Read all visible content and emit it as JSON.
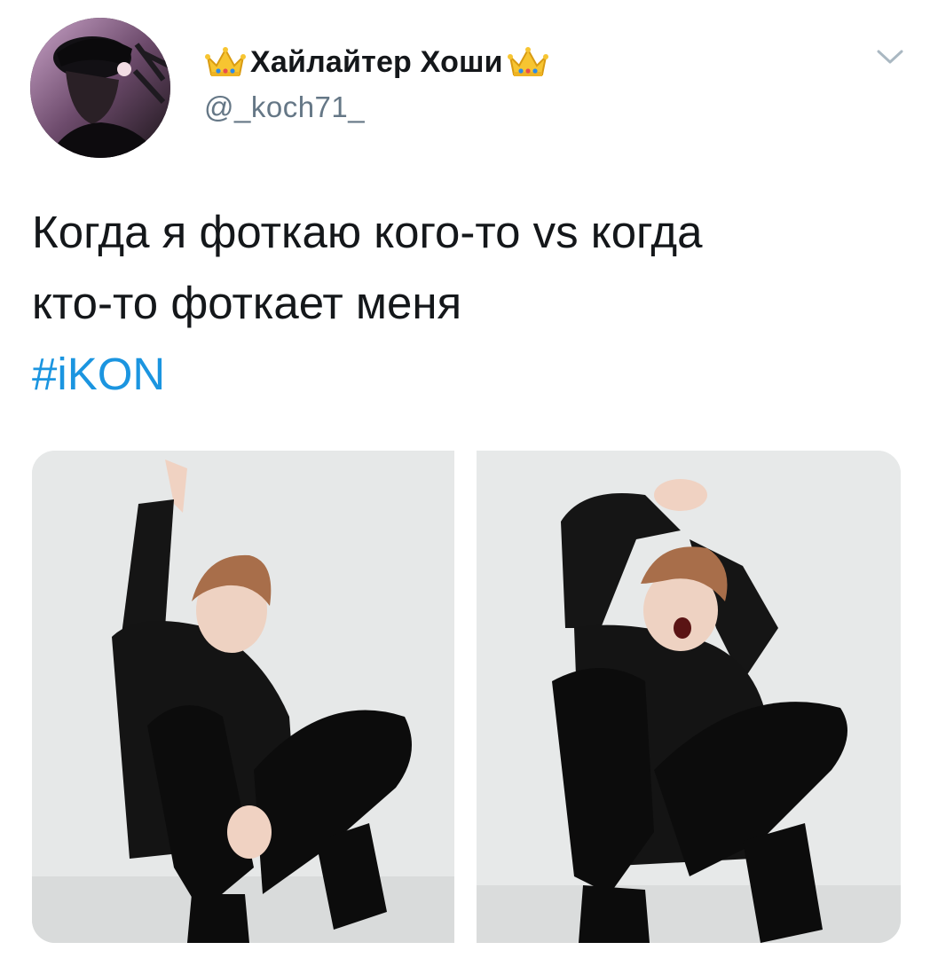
{
  "user": {
    "display_name": "Хайлайтер Хоши",
    "handle": "@_koch71_",
    "name_decoration_icon": "crown-icon"
  },
  "tweet": {
    "text_line1": "Когда я фоткаю кого-то vs когда",
    "text_line2": "кто-то фоткает меня",
    "hashtag": "#iKON"
  },
  "media": {
    "count": 2,
    "images": [
      {
        "description_icon": "photo-pose-sitting-calm"
      },
      {
        "description_icon": "photo-pose-sitting-screaming"
      }
    ]
  },
  "colors": {
    "text": "#14171a",
    "handle": "#657786",
    "hashtag": "#1b95e0",
    "background": "#ffffff"
  }
}
